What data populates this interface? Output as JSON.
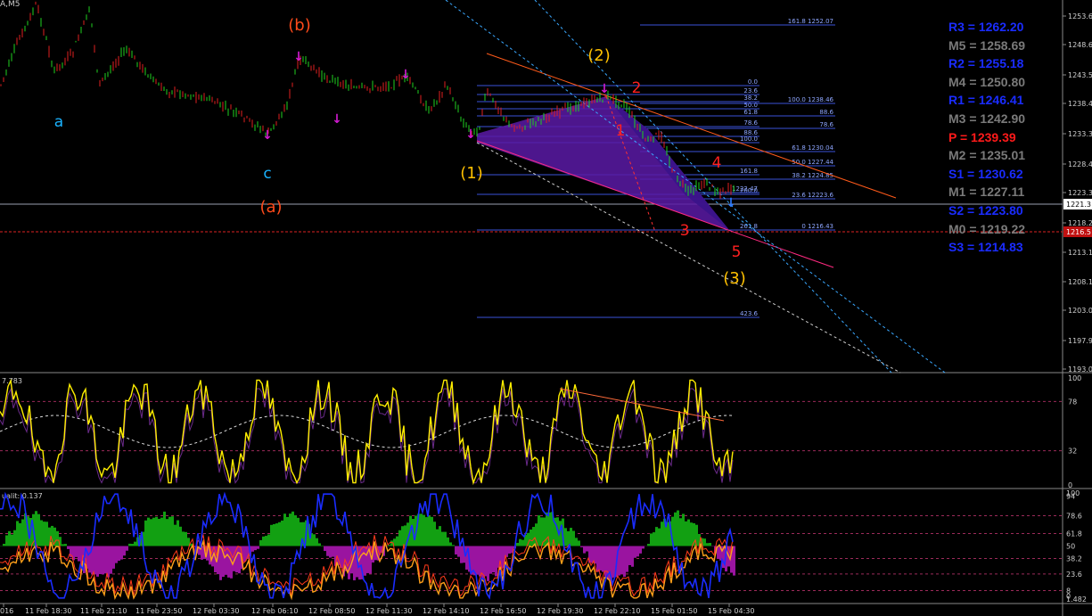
{
  "window_title": "А,M5",
  "chart_data": [
    {
      "type": "line",
      "name": "price",
      "series": "candlestick",
      "y_ticks": [
        "1253.6",
        "1248.6",
        "1243.5",
        "1238.4",
        "1233.3",
        "1228.4",
        "1223.3",
        "1218.2",
        "1213.1",
        "1208.1",
        "1203.0",
        "1197.9",
        "1193.0"
      ],
      "current_price": "1221.3",
      "bid_price": "1216.5",
      "wave_labels": [
        {
          "text": "(b)",
          "color": "#ff4a1a"
        },
        {
          "text": "(2)",
          "color": "#ffc000"
        },
        {
          "text": "2",
          "color": "#ff2020"
        },
        {
          "text": "a",
          "color": "#1ab3ff"
        },
        {
          "text": "1",
          "color": "#ff2020"
        },
        {
          "text": "c",
          "color": "#1ab3ff"
        },
        {
          "text": "4",
          "color": "#ff2020"
        },
        {
          "text": "(1)",
          "color": "#ffc000"
        },
        {
          "text": "(a)",
          "color": "#ff4a1a"
        },
        {
          "text": "3",
          "color": "#ff2020"
        },
        {
          "text": "5",
          "color": "#ff2020"
        },
        {
          "text": "(3)",
          "color": "#ffc000"
        }
      ],
      "fib_labels_left": [
        "0.0",
        "23.6",
        "38.2",
        "50.0",
        "61.8",
        "78.6",
        "88.6",
        "100.0",
        "161.8",
        "200.0",
        "261.8",
        "423.6"
      ],
      "fib_labels_right": [
        "161.8 1252.07",
        "100.0 1238.46",
        "88.6",
        "78.6",
        "61.8 1230.04",
        "50.0 1227.44",
        "38.2 1224.85",
        "23.6 12223.6",
        "0 1216.43",
        "1222.47"
      ],
      "pivots": [
        {
          "label": "R3 = 1262.20",
          "color": "#1a2cff"
        },
        {
          "label": "M5 = 1258.69",
          "color": "#7a7a7a"
        },
        {
          "label": "R2 = 1255.18",
          "color": "#1a2cff"
        },
        {
          "label": "M4 = 1250.80",
          "color": "#7a7a7a"
        },
        {
          "label": "R1 = 1246.41",
          "color": "#1a2cff"
        },
        {
          "label": "M3 = 1242.90",
          "color": "#7a7a7a"
        },
        {
          "label": "P  = 1239.39",
          "color": "#ff1a1a"
        },
        {
          "label": "M2 = 1235.01",
          "color": "#7a7a7a"
        },
        {
          "label": "S1 = 1230.62",
          "color": "#1a2cff"
        },
        {
          "label": "M1 = 1227.11",
          "color": "#7a7a7a"
        },
        {
          "label": "S2 = 1223.80",
          "color": "#1a2cff"
        },
        {
          "label": "M0 = 1219.22",
          "color": "#7a7a7a"
        },
        {
          "label": "S3 = 1214.83",
          "color": "#1a2cff"
        }
      ]
    },
    {
      "type": "line",
      "name": "oscillator-1",
      "header": "7.783",
      "y_ticks": [
        "100",
        "78",
        "32",
        "0"
      ],
      "ylim": [
        0,
        100
      ]
    },
    {
      "type": "line",
      "name": "oscillator-2",
      "header": "ualit: 0.137",
      "y_ticks": [
        "100",
        "94",
        "78.6",
        "61.8",
        "50",
        "38.2",
        "23.6",
        "8",
        "0",
        "1.482"
      ],
      "ylim": [
        0,
        100
      ]
    }
  ],
  "x_ticks": [
    "016",
    "11 Feb 18:30",
    "11 Feb 21:10",
    "11 Feb 23:50",
    "12 Feb 03:30",
    "12 Feb 06:10",
    "12 Feb 08:50",
    "12 Feb 11:30",
    "12 Feb 14:10",
    "12 Feb 16:50",
    "12 Feb 19:30",
    "12 Feb 22:10",
    "15 Feb 01:50",
    "15 Feb 04:30"
  ]
}
